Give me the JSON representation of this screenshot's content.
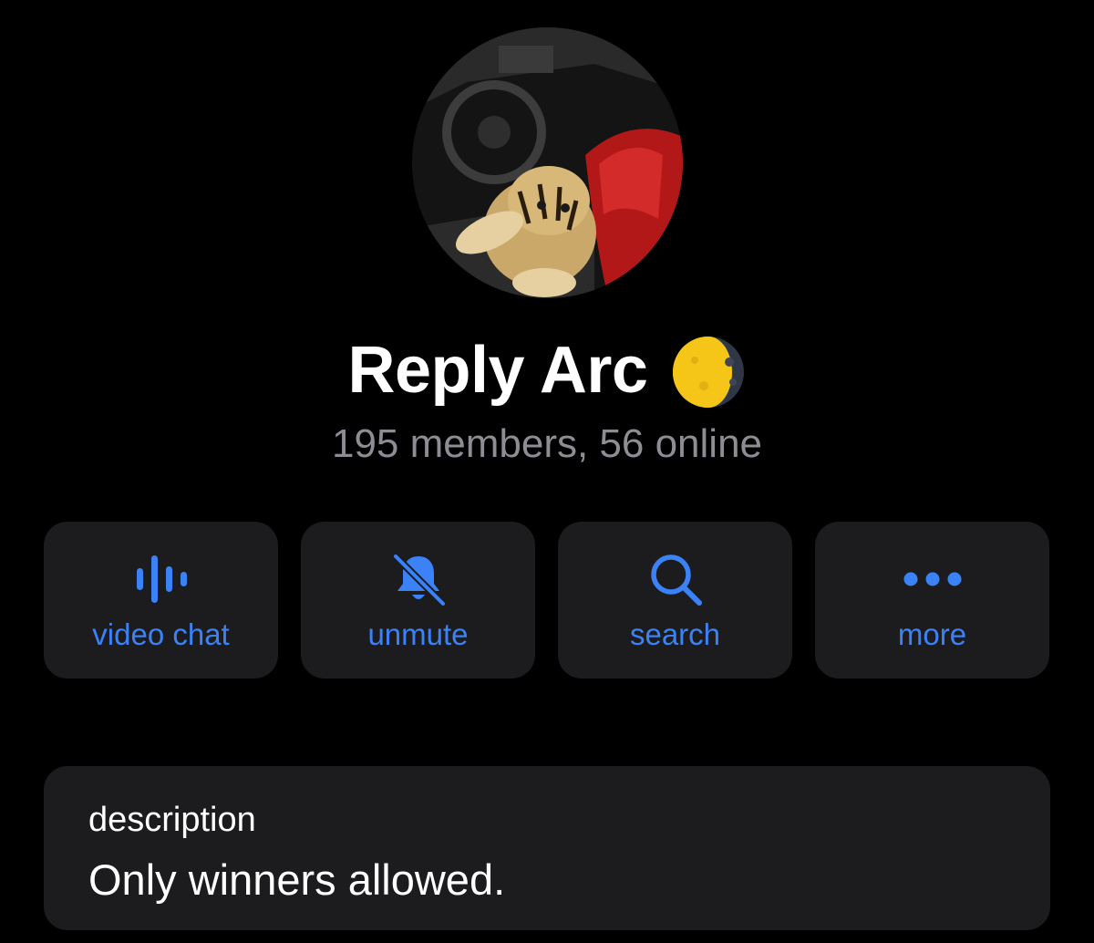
{
  "profile": {
    "title": "Reply Arc",
    "subtitle": "195 members, 56 online",
    "avatar_icon": "group-avatar-tiger-in-car",
    "title_emoji_icon": "moon-icon"
  },
  "actions": [
    {
      "label": "video chat",
      "icon": "sound-wave-icon"
    },
    {
      "label": "unmute",
      "icon": "bell-slash-icon"
    },
    {
      "label": "search",
      "icon": "search-icon"
    },
    {
      "label": "more",
      "icon": "ellipsis-icon"
    }
  ],
  "description": {
    "label": "description",
    "text": "Only winners allowed."
  },
  "colors": {
    "background": "#000000",
    "card": "#1c1c1e",
    "accent": "#3b82f6",
    "secondary_text": "#8d8d93"
  }
}
